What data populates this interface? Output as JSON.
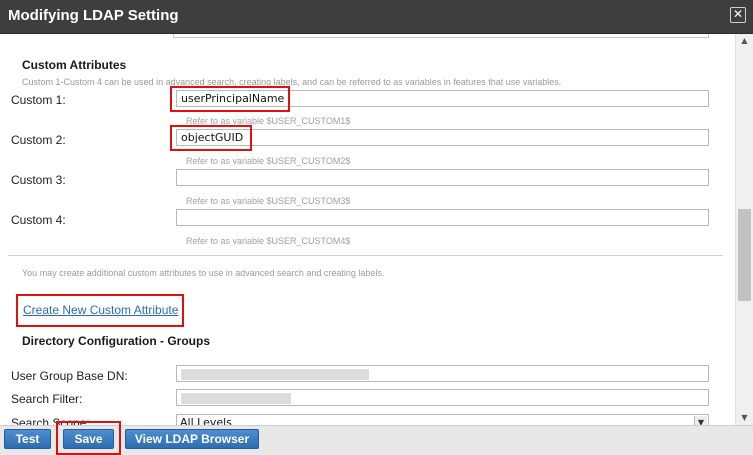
{
  "window": {
    "title": "Modifying LDAP Setting",
    "close_glyph": "✕"
  },
  "custom_attributes": {
    "heading": "Custom Attributes",
    "note": "Custom 1-Custom 4 can be used in advanced search, creating labels, and can be referred to as variables in features that use variables.",
    "fields": [
      {
        "label": "Custom 1:",
        "value": "userPrincipalName",
        "hint": "Refer to as variable $USER_CUSTOM1$"
      },
      {
        "label": "Custom 2:",
        "value": "objectGUID",
        "hint": "Refer to as variable $USER_CUSTOM2$"
      },
      {
        "label": "Custom 3:",
        "value": "",
        "hint": "Refer to as variable $USER_CUSTOM3$"
      },
      {
        "label": "Custom 4:",
        "value": "",
        "hint": "Refer to as variable $USER_CUSTOM4$"
      }
    ],
    "additional_note": "You may create additional custom attributes to use in advanced search and creating labels.",
    "create_link": "Create New Custom Attribute"
  },
  "directory_groups": {
    "heading": "Directory Configuration - Groups",
    "fields": [
      {
        "label": "User Group Base DN:",
        "value": ""
      },
      {
        "label": "Search Filter:",
        "value": ""
      },
      {
        "label": "Search Scope:",
        "value": "All Levels"
      }
    ]
  },
  "footer": {
    "test_label": "Test",
    "save_label": "Save",
    "browser_label": "View LDAP Browser"
  },
  "icons": {
    "scroll_up": "▲",
    "scroll_down": "▼",
    "select_arrow": "▼"
  },
  "colors": {
    "titlebar": "#3e3e3e",
    "button": "#2c6cb0",
    "highlight": "#e01010",
    "link": "#2a6db0"
  }
}
